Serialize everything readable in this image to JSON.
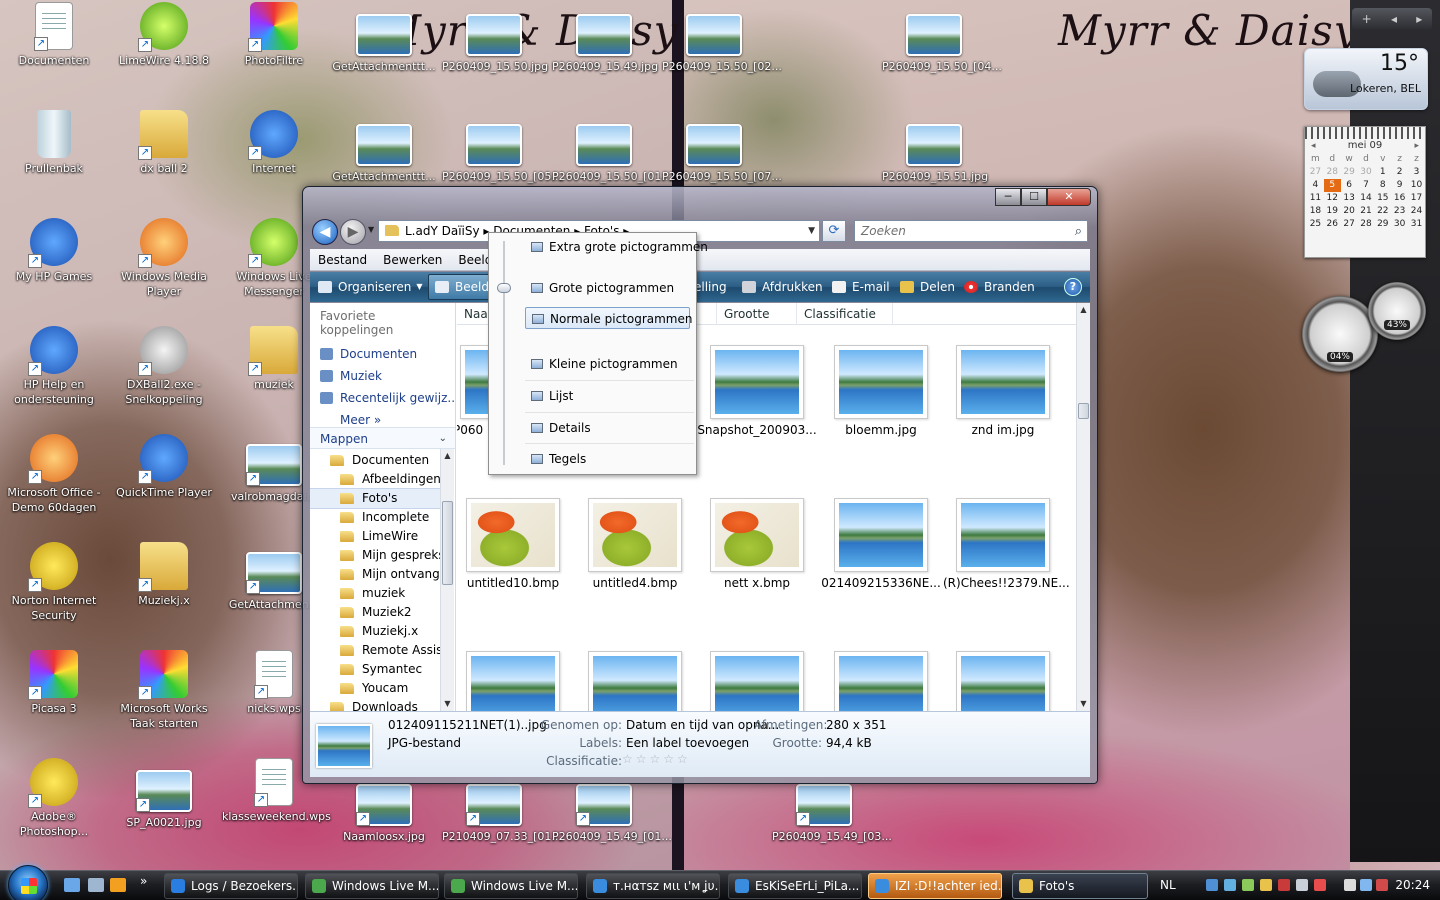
{
  "wallpaper": {
    "left_title": "Myrr & Daisy",
    "right_title": "Myrr & Daisy"
  },
  "desktop_icons": [
    {
      "label": "Documenten",
      "icon": "documents-icon"
    },
    {
      "label": "LimeWire 4.18.8",
      "icon": "limewire-icon"
    },
    {
      "label": "PhotoFiltre",
      "icon": "photofiltre-icon"
    },
    {
      "label": "GetAttachmenttt...",
      "icon": "image-file-icon"
    },
    {
      "label": "P260409_15.50.jpg",
      "icon": "image-file-icon"
    },
    {
      "label": "P260409_15.49.jpg",
      "icon": "image-file-icon"
    },
    {
      "label": "P260409_15.50_[02...",
      "icon": "image-file-icon"
    },
    {
      "label": "P260409_15.50_[04...",
      "icon": "image-file-icon"
    },
    {
      "label": "Prullenbak",
      "icon": "recycle-bin-icon"
    },
    {
      "label": "dx ball 2",
      "icon": "folder-icon"
    },
    {
      "label": "Internet",
      "icon": "internet-explorer-icon"
    },
    {
      "label": "GetAttachmenttt...",
      "icon": "image-file-icon"
    },
    {
      "label": "P260409_15.50_[05...",
      "icon": "image-file-icon"
    },
    {
      "label": "P260409_15.50_[01...",
      "icon": "image-file-icon"
    },
    {
      "label": "P260409_15.50_[07...",
      "icon": "image-file-icon"
    },
    {
      "label": "P260409_15.51.jpg",
      "icon": "image-file-icon"
    },
    {
      "label": "My HP Games",
      "icon": "hp-games-icon"
    },
    {
      "label": "Windows Media Player",
      "icon": "media-player-icon"
    },
    {
      "label": "Windows Live Messenger",
      "icon": "messenger-icon"
    },
    {
      "label": "HP Help en ondersteuning",
      "icon": "help-icon"
    },
    {
      "label": "DXBall2.exe - Snelkoppeling",
      "icon": "dxball-icon"
    },
    {
      "label": "muziek",
      "icon": "folder-icon"
    },
    {
      "label": "Microsoft Office - Demo 60dagen",
      "icon": "office-icon"
    },
    {
      "label": "QuickTime Player",
      "icon": "quicktime-icon"
    },
    {
      "label": "valrobmagdai...",
      "icon": "image-file-icon"
    },
    {
      "label": "Norton Internet Security",
      "icon": "norton-icon"
    },
    {
      "label": "Muziekj.x",
      "icon": "folder-icon"
    },
    {
      "label": "GetAttachmen...",
      "icon": "image-file-icon"
    },
    {
      "label": "Picasa 3",
      "icon": "picasa-icon"
    },
    {
      "label": "Microsoft Works Taak starten",
      "icon": "works-icon"
    },
    {
      "label": "nicks.wps",
      "icon": "document-icon"
    },
    {
      "label": "Adobe® Photoshop...",
      "icon": "photoshop-icon"
    },
    {
      "label": "SP_A0021.jpg",
      "icon": "image-file-icon"
    },
    {
      "label": "klasseweekend.wps",
      "icon": "document-icon"
    },
    {
      "label": "Naamloosx.jpg",
      "icon": "image-file-icon"
    },
    {
      "label": "P210409_07.33_[01...",
      "icon": "image-file-icon"
    },
    {
      "label": "P260409_15.49_[01...",
      "icon": "image-file-icon"
    },
    {
      "label": "P260409_15.49_[03...",
      "icon": "image-file-icon"
    }
  ],
  "gadgets": {
    "weather": {
      "temperature": "15°",
      "city": "Lokeren, BEL"
    },
    "calendar": {
      "month": "mei 09",
      "weekdays": [
        "m",
        "d",
        "w",
        "d",
        "v",
        "z",
        "z"
      ],
      "weeks": [
        [
          "27",
          "28",
          "29",
          "30",
          "1",
          "2",
          "3"
        ],
        [
          "4",
          "5",
          "6",
          "7",
          "8",
          "9",
          "10"
        ],
        [
          "11",
          "12",
          "13",
          "14",
          "15",
          "16",
          "17"
        ],
        [
          "18",
          "19",
          "20",
          "21",
          "22",
          "23",
          "24"
        ],
        [
          "25",
          "26",
          "27",
          "28",
          "29",
          "30",
          "31"
        ]
      ],
      "today": "5"
    },
    "meters": {
      "cpu": "04%",
      "ram": "43%"
    }
  },
  "explorer": {
    "address": "L.adY DaïiSy ▸ Documenten ▸ Foto's ▸",
    "search_placeholder": "Zoeken",
    "menu": [
      "Bestand",
      "Bewerken",
      "Beeld"
    ],
    "commands": {
      "organize": "Organiseren",
      "view": "Beeld",
      "slideshow": "elling",
      "print": "Afdrukken",
      "email": "E-mail",
      "share": "Delen",
      "burn": "Branden",
      "help": "?"
    },
    "nav": {
      "favorites_title": "Favoriete koppelingen",
      "favorites": [
        "Documenten",
        "Muziek",
        "Recentelijk gewijz...",
        "Meer"
      ],
      "more_arrows": "»",
      "folders_title": "Mappen",
      "tree": [
        "Documenten",
        "Afbeeldingen",
        "Foto's",
        "Incomplete",
        "LimeWire",
        "Mijn gespreks",
        "Mijn ontvange",
        "muziek",
        "Muziek2",
        "Muziekj.x",
        "Remote Assist",
        "Symantec",
        "Youcam",
        "Downloads"
      ]
    },
    "columns": [
      "Naam",
      "Grootte",
      "Classificatie"
    ],
    "files": [
      {
        "name": "P060",
        "type": "lake"
      },
      {
        "name": "Snapshot_200903...",
        "type": "lake"
      },
      {
        "name": "bloemm.jpg",
        "type": "lake"
      },
      {
        "name": "znd im.jpg",
        "type": "lake"
      },
      {
        "name": "untitled10.bmp",
        "type": "paint"
      },
      {
        "name": "untitled4.bmp",
        "type": "paint"
      },
      {
        "name": "nett x.bmp",
        "type": "paint"
      },
      {
        "name": "021409215336NE...",
        "type": "lake"
      },
      {
        "name": "(R)Chees!!2379.NE...",
        "type": "lake"
      },
      {
        "name": "",
        "type": "lake"
      },
      {
        "name": "",
        "type": "lake"
      },
      {
        "name": "",
        "type": "lake"
      },
      {
        "name": "",
        "type": "lake"
      },
      {
        "name": "",
        "type": "lake"
      }
    ],
    "view_menu": {
      "extra_large": "Extra grote pictogrammen",
      "large": "Grote pictogrammen",
      "normal": "Normale pictogrammen",
      "small": "Kleine pictogrammen",
      "list": "Lijst",
      "details": "Details",
      "tiles": "Tegels"
    },
    "details_pane": {
      "filename": "012409115211NET(1)..jpg",
      "filetype": "JPG-bestand",
      "taken_label": "Genomen op:",
      "taken_value": "Datum en tijd van opna...",
      "dims_label": "Afmetingen:",
      "dims_value": "280 x 351",
      "labels_label": "Labels:",
      "labels_value": "Een label toevoegen",
      "size_label": "Grootte:",
      "size_value": "94,4 kB",
      "rating_label": "Classificatie:",
      "rating_stars": "☆☆☆☆☆"
    }
  },
  "taskbar": {
    "items": [
      {
        "label": "Logs / Bezoekers...",
        "color": "#2a7de1"
      },
      {
        "label": "Windows Live M...",
        "color": "#4ca84c"
      },
      {
        "label": "Windows Live M...",
        "color": "#4ca84c"
      },
      {
        "label": "т.нαтѕz мιι ι'м ʝυ...",
        "color": "#3a8dde"
      },
      {
        "label": "EsKiSeErLi_PiLa...",
        "color": "#3a8dde"
      },
      {
        "label": "IZI :D!!achter ied...",
        "color": "#3a8dde"
      },
      {
        "label": "Foto's",
        "color": "#e8c24a"
      }
    ],
    "language": "NL",
    "clock": "20:24"
  }
}
